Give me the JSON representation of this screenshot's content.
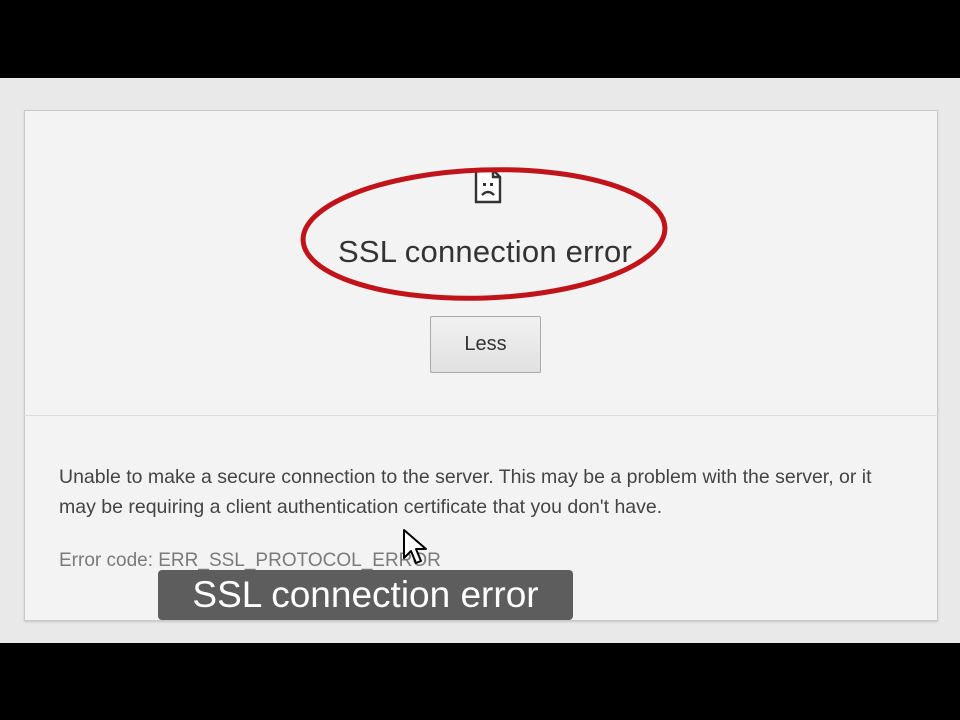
{
  "error_page": {
    "icon": "sad-document-icon",
    "title": "SSL connection error",
    "less_button_label": "Less",
    "details": "Unable to make a secure connection to the server. This may be a problem with the server, or it may be requiring a client authentication certificate that you don't have.",
    "error_code": "Error code: ERR_SSL_PROTOCOL_ERROR"
  },
  "overlay": {
    "caption": "SSL connection error",
    "highlight_color": "#c0141a",
    "cursor": "mouse-pointer-icon"
  }
}
